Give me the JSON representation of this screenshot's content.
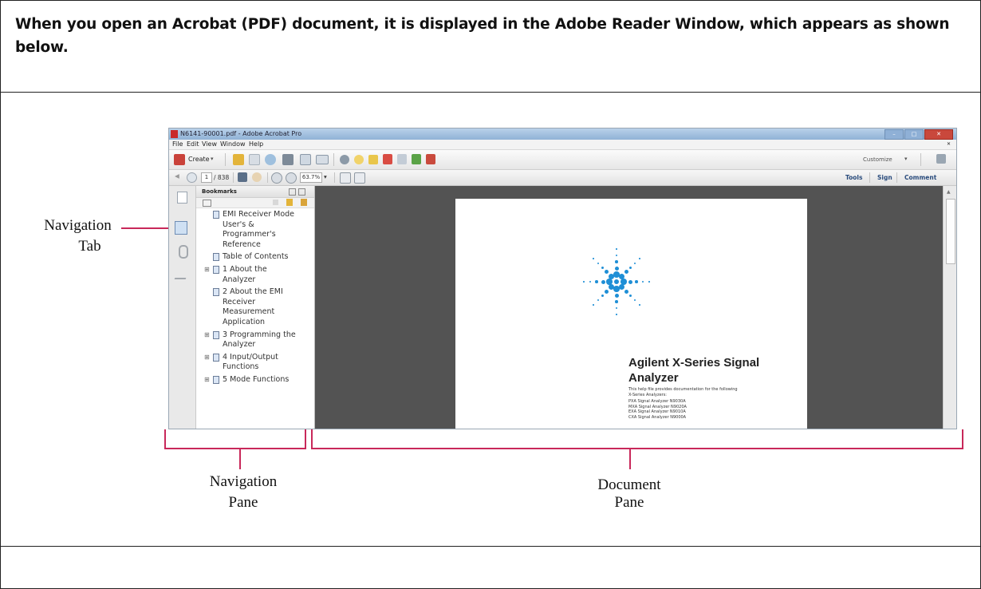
{
  "heading": "When you open an Acrobat (PDF) document, it is displayed in the Adobe Reader Window, which appears as shown below.",
  "callouts": {
    "navigation_tab": [
      "Navigation",
      "Tab"
    ],
    "navigation_pane": [
      "Navigation",
      "Pane"
    ],
    "document_pane": [
      "Document",
      "Pane"
    ]
  },
  "window": {
    "title": "N6141-90001.pdf - Adobe Acrobat Pro",
    "menu": [
      "File",
      "Edit",
      "View",
      "Window",
      "Help"
    ],
    "create_label": "Create",
    "customize_label": "Customize",
    "page_current": "1",
    "page_total": "/ 838",
    "zoom": "63.7%",
    "right_tabs": [
      "Tools",
      "Sign",
      "Comment"
    ]
  },
  "nav_pane": {
    "title": "Bookmarks",
    "bookmarks": [
      {
        "lines": [
          "EMI Receiver Mode",
          "User's &",
          "Programmer's",
          "Reference"
        ],
        "expandable": false
      },
      {
        "lines": [
          "Table of Contents"
        ],
        "expandable": false
      },
      {
        "lines": [
          "1  About the",
          "Analyzer"
        ],
        "expandable": true
      },
      {
        "lines": [
          "2  About the EMI",
          "Receiver",
          "Measurement",
          "Application"
        ],
        "expandable": false
      },
      {
        "lines": [
          "3  Programming the",
          "Analyzer"
        ],
        "expandable": true
      },
      {
        "lines": [
          "4  Input/Output",
          "Functions"
        ],
        "expandable": true
      },
      {
        "lines": [
          "5  Mode Functions"
        ],
        "expandable": true
      }
    ]
  },
  "document": {
    "title_line1": "Agilent X-Series Signal",
    "title_line2": "Analyzer",
    "body_lines": [
      "This help file provides documentation for the following",
      "X-Series Analyzers:",
      "PXA Signal Analyzer N9030A",
      "MXA Signal Analyzer N9020A",
      "EXA Signal Analyzer N9010A",
      "CXA Signal Analyzer N9000A"
    ]
  }
}
